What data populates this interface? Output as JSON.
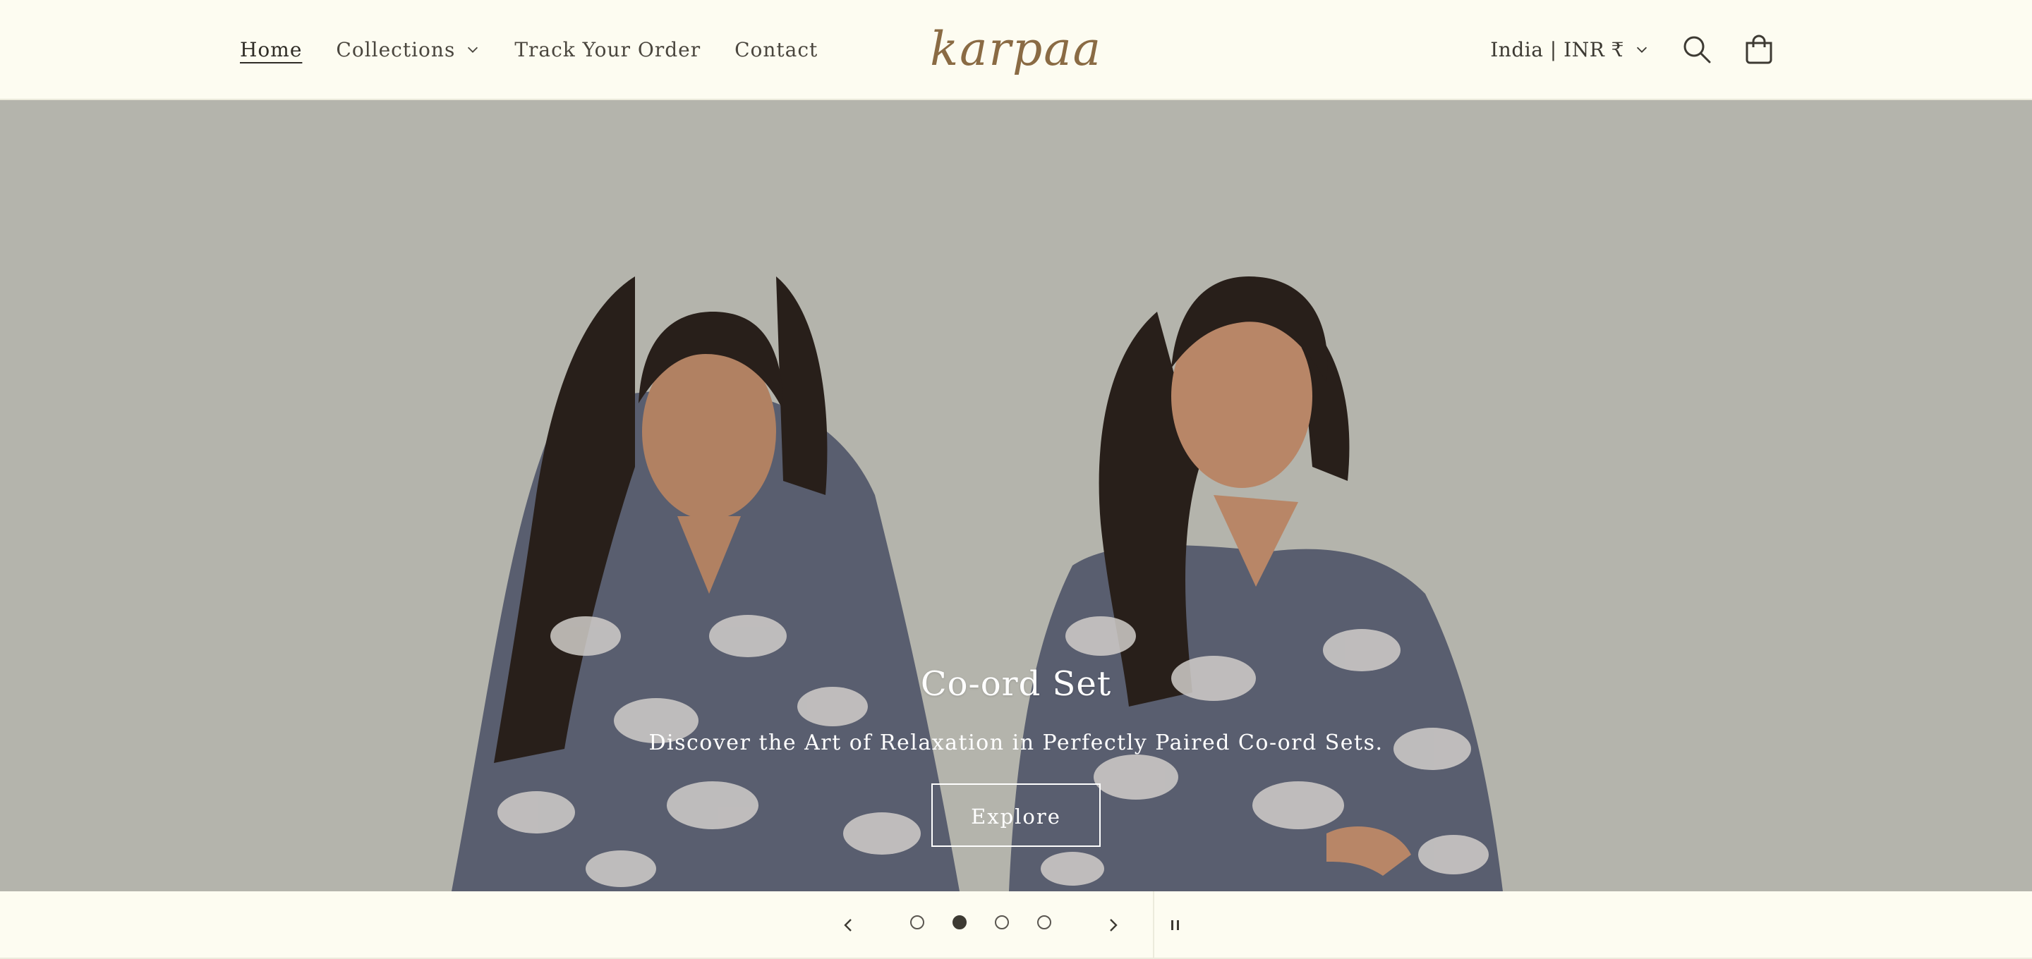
{
  "nav": {
    "items": [
      {
        "label": "Home",
        "active": true
      },
      {
        "label": "Collections",
        "has_dropdown": true
      },
      {
        "label": "Track Your Order"
      },
      {
        "label": "Contact"
      }
    ]
  },
  "brand": {
    "logo_text": "karpaa",
    "logo_color": "#8a6b44"
  },
  "header": {
    "country_selector": "India | INR ₹",
    "search_icon": "search-icon",
    "cart_icon": "cart-icon"
  },
  "hero": {
    "title": "Co-ord Set",
    "subtitle": "Discover the Art of Relaxation in Perfectly Paired Co-ord Sets.",
    "button_label": "Explore",
    "background_color": "#bcbcb3"
  },
  "slider": {
    "slide_count": 4,
    "active_index": 1,
    "prev_icon": "chevron-left-icon",
    "next_icon": "chevron-right-icon",
    "pause_icon": "pause-icon"
  },
  "colors": {
    "page_background": "#fdfcf1",
    "text": "#3d3a33"
  }
}
